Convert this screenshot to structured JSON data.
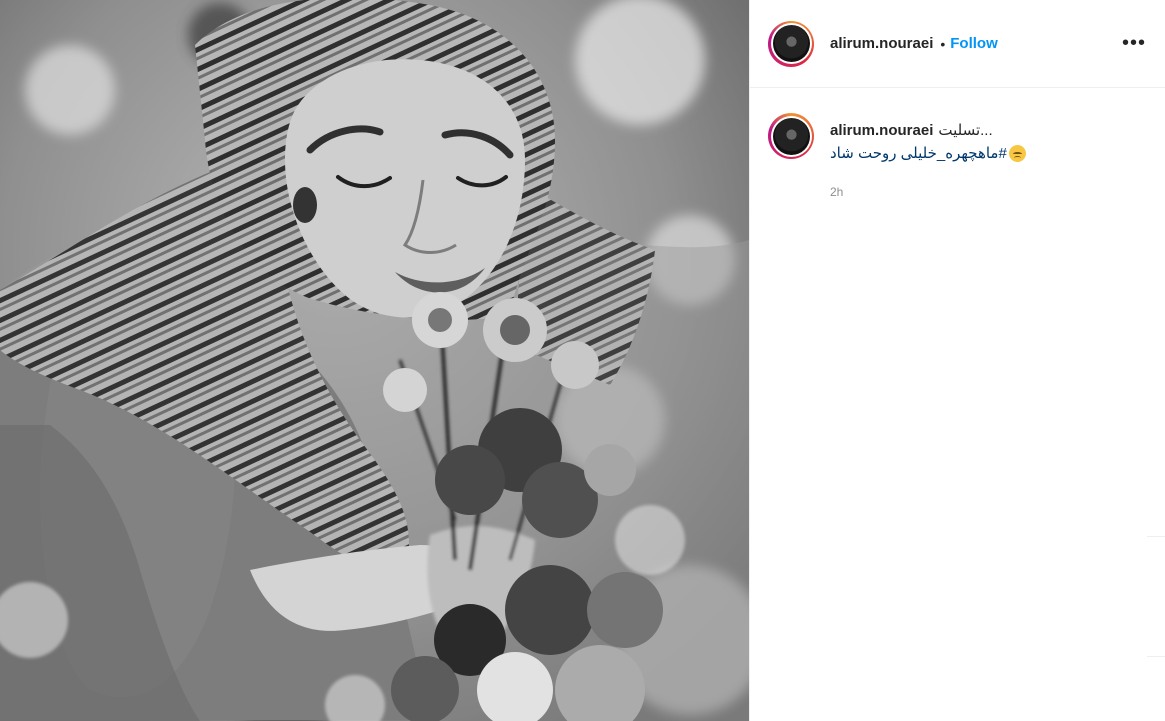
{
  "post": {
    "username": "alirum.nouraei",
    "separator": "•",
    "follow_label": "Follow",
    "more_icon": "•••",
    "caption": {
      "username": "alirum.nouraei",
      "text": "تسلیت...",
      "hashtag": "#ماهچهره_خلیلی روحت شاد",
      "emoji": "pensive-face-icon"
    },
    "timestamp": "2h"
  }
}
